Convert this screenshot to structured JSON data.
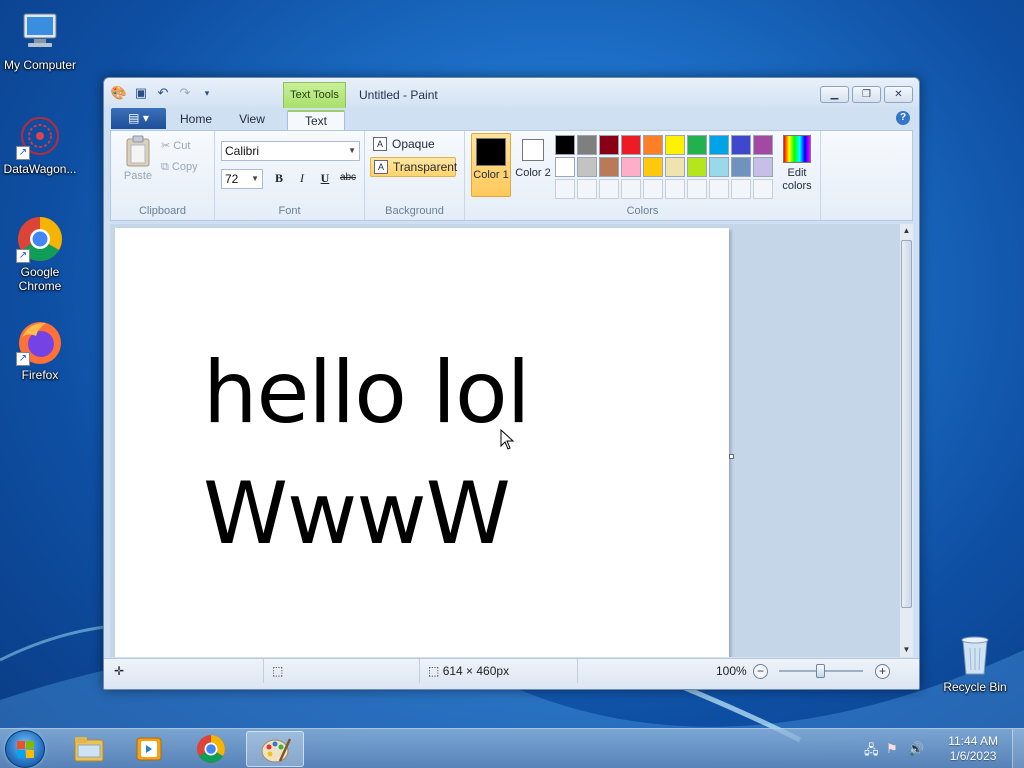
{
  "desktop": {
    "icons": [
      {
        "label": "My Computer"
      },
      {
        "label": "DataWagon..."
      },
      {
        "label": "Google Chrome"
      },
      {
        "label": "Firefox"
      },
      {
        "label": "Recycle Bin"
      }
    ]
  },
  "window": {
    "title": "Untitled - Paint",
    "context_tab": "Text Tools",
    "tabs": [
      "Home",
      "View",
      "Text"
    ],
    "active_tab": "Text",
    "file_menu_glyph": "▤ ▾"
  },
  "ribbon": {
    "clipboard": {
      "label": "Clipboard",
      "paste": "Paste",
      "cut": "Cut",
      "copy": "Copy"
    },
    "font": {
      "label": "Font",
      "family": "Calibri",
      "size": "72",
      "bold": "B",
      "italic": "I",
      "underline": "U",
      "strike": "abc"
    },
    "background": {
      "label": "Background",
      "opaque": "Opaque",
      "transparent": "Transparent",
      "selected": "Transparent"
    },
    "colors": {
      "label": "Colors",
      "color1_label": "Color 1",
      "color1": "#000000",
      "color2_label": "Color 2",
      "color2": "#ffffff",
      "edit_colors": "Edit colors",
      "palette_row1": [
        "#000000",
        "#7f7f7f",
        "#880015",
        "#ed1c24",
        "#ff7f27",
        "#fff200",
        "#22b14c",
        "#00a2e8",
        "#3f48cc",
        "#a349a4"
      ],
      "palette_row2": [
        "#ffffff",
        "#c3c3c3",
        "#b97a57",
        "#ffaec9",
        "#ffc90e",
        "#efe4b0",
        "#b5e61d",
        "#99d9ea",
        "#7092be",
        "#c8bfe7"
      ]
    }
  },
  "canvas": {
    "text_lines": [
      "hello lol",
      "WwwW"
    ],
    "size_label": "614 × 460px"
  },
  "statusbar": {
    "zoom": "100%",
    "zoom_out": "−",
    "zoom_in": "+"
  },
  "taskbar": {
    "clock_time": "11:44 AM",
    "clock_date": "1/6/2023"
  },
  "colors": {
    "accent": "#1e6ec6",
    "selection": "#ffd36b"
  }
}
